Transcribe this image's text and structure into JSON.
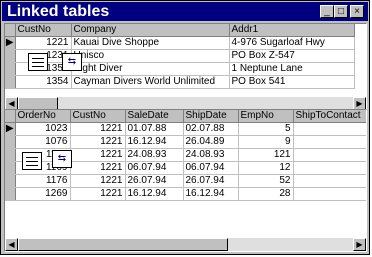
{
  "window": {
    "title": "Linked tables",
    "buttons": {
      "minimize": "_",
      "maximize": "□",
      "close": "×"
    }
  },
  "master": {
    "columns": [
      "CustNo",
      "Company",
      "Addr1"
    ],
    "rows": [
      [
        "1221",
        "Kauai Dive Shoppe",
        "4-976 Sugarloaf Hwy"
      ],
      [
        "1231",
        "Unisco",
        "PO Box Z-547"
      ],
      [
        "1351",
        "Sight Diver",
        "1 Neptune Lane"
      ],
      [
        "1354",
        "Cayman Divers World Unlimited",
        "PO Box 541"
      ]
    ]
  },
  "detail": {
    "columns": [
      "OrderNo",
      "CustNo",
      "SaleDate",
      "ShipDate",
      "EmpNo",
      "ShipToContact"
    ],
    "rows": [
      [
        "1023",
        "1221",
        "01.07.88",
        "02.07.88",
        "5",
        ""
      ],
      [
        "1076",
        "1221",
        "16.12.94",
        "26.04.89",
        "9",
        ""
      ],
      [
        "1123",
        "1221",
        "24.08.93",
        "24.08.93",
        "121",
        ""
      ],
      [
        "1169",
        "1221",
        "06.07.94",
        "06.07.94",
        "12",
        ""
      ],
      [
        "1176",
        "1221",
        "26.07.94",
        "26.07.94",
        "52",
        ""
      ],
      [
        "1269",
        "1221",
        "16.12.94",
        "16.12.94",
        "28",
        ""
      ]
    ]
  }
}
